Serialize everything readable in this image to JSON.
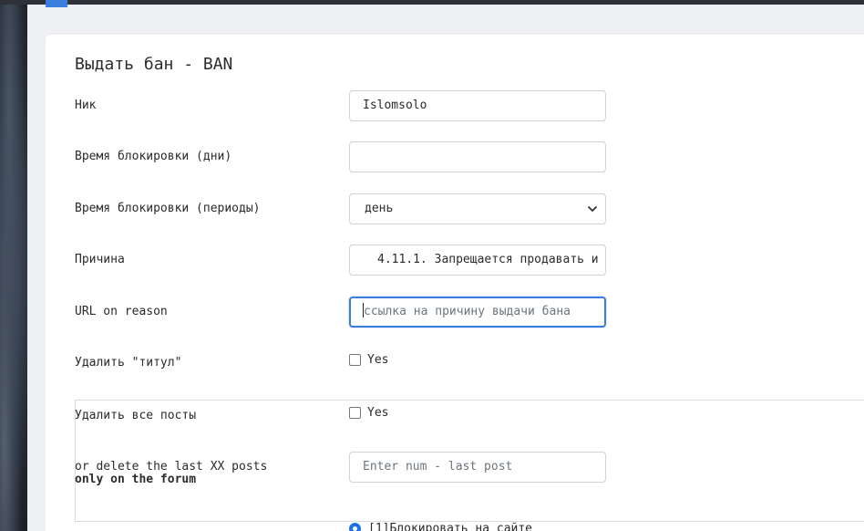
{
  "form": {
    "title": "Выдать бан - BAN",
    "nick": {
      "label": "Ник",
      "value": "Islomsolo"
    },
    "ban_days": {
      "label": "Время блокировки (дни)",
      "value": ""
    },
    "ban_period": {
      "label": "Время блокировки (периоды)",
      "selected": "день"
    },
    "reason": {
      "label": "Причина",
      "selected": "4.11.1. Запрещается продавать и"
    },
    "url_reason": {
      "label": "URL on reason",
      "placeholder": "ссылка на причину выдачи бана"
    },
    "remove_title": {
      "label": "Удалить \"титул\"",
      "checkbox_label": "Yes",
      "checked": false
    },
    "delete_posts": {
      "label": "Удалить все посты",
      "checkbox_label": "Yes",
      "checked": false,
      "last_label_1": "or delete the last XX posts",
      "last_label_2": "only on the forum",
      "last_placeholder": "Enter num -  last post"
    },
    "block_option": {
      "label": "[1]Блокировать на сайте",
      "selected": true
    }
  },
  "colors": {
    "accent": "#3b7ddd",
    "topbar": "#2e3138"
  },
  "icons": {
    "select": "chevron-down-icon"
  }
}
